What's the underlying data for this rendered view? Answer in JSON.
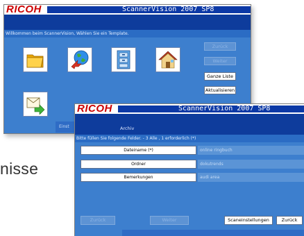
{
  "page_fragment": "nisse",
  "brand": "RICOH",
  "back_window": {
    "title": "ScannerVision 2007 SP8",
    "welcome": "Willkommen beim ScannerVision, Wählen Sie ein Template.",
    "side_buttons": {
      "back": "Zurück",
      "next": "Weiter",
      "full_list": "Ganze Liste",
      "refresh": "Aktualisieren"
    },
    "bottom_label": "Einst",
    "icons": [
      "folder-icon",
      "globe-arrow-icon",
      "filing-cabinet-icon",
      "home-icon",
      "mail-forward-icon"
    ]
  },
  "front_window": {
    "title": "ScannerVision 2007 SP8",
    "section_title": "Archiv",
    "instruction": "Bitte füllen Sie folgende Felder. - 3 Alle , 1 erforderlich (*)",
    "fields": [
      {
        "label": "Dateiname (*)",
        "value": "online ringbuch"
      },
      {
        "label": "Ordner",
        "value": "dokutrends"
      },
      {
        "label": "Bemerkungen",
        "value": "audi area"
      }
    ],
    "buttons": {
      "back": "Zurück",
      "next": "Weiter",
      "scan_settings": "Scaneinstellungen",
      "back2": "Zurück"
    }
  },
  "colors": {
    "brand_red": "#cc0000",
    "title_blue": "#0c39a6",
    "panel_blue": "#3d7fce",
    "dark_strip": "#0e3c9c"
  }
}
